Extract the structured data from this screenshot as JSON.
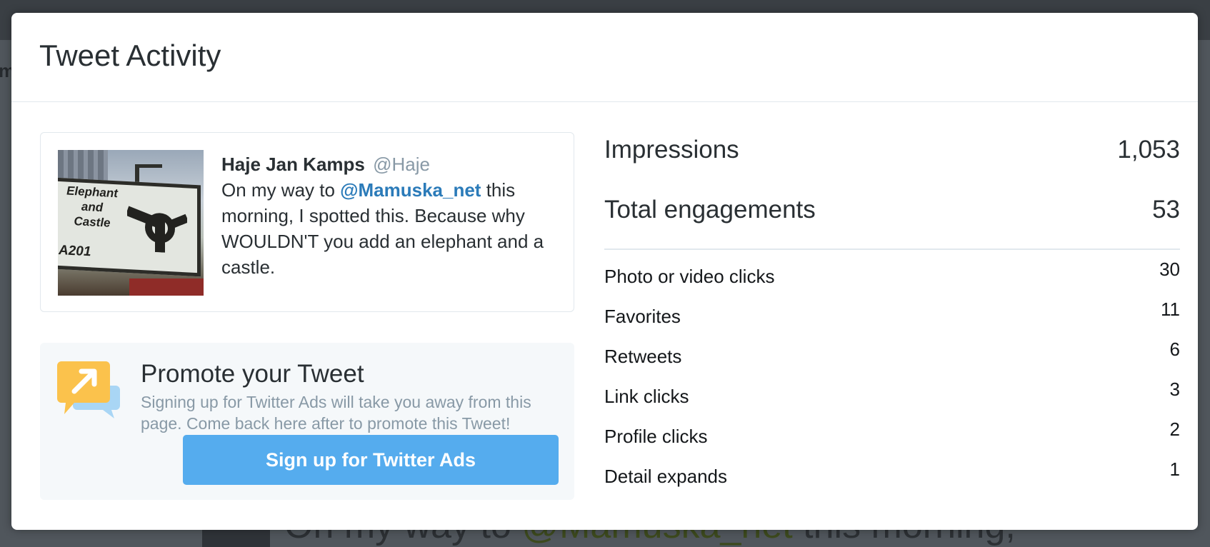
{
  "modal": {
    "title": "Tweet Activity"
  },
  "tweet": {
    "author_name": "Haje Jan Kamps",
    "author_handle": "@Haje",
    "text_before": "On my way to ",
    "mention": "@Mamuska_net",
    "text_after": " this morning, I spotted this. Because why WOULDN'T you add an elephant and a castle.",
    "photo": {
      "sign_lines": [
        "Elephant",
        "and",
        "Castle"
      ],
      "sign_road": "A201"
    }
  },
  "promote": {
    "title": "Promote your Tweet",
    "description": "Signing up for Twitter Ads will take you away from this page. Come back here after to promote this Tweet!",
    "button_label": "Sign up for Twitter Ads",
    "icon": "promote-tweet-icon"
  },
  "stats": {
    "impressions": {
      "label": "Impressions",
      "value": "1,053"
    },
    "total_engagements": {
      "label": "Total engagements",
      "value": "53"
    },
    "breakdown": [
      {
        "label": "Photo or video clicks",
        "value": "30"
      },
      {
        "label": "Favorites",
        "value": "11"
      },
      {
        "label": "Retweets",
        "value": "6"
      },
      {
        "label": "Link clicks",
        "value": "3"
      },
      {
        "label": "Profile clicks",
        "value": "2"
      },
      {
        "label": "Detail expands",
        "value": "1"
      }
    ]
  },
  "background": {
    "tweet_text_start": "On my way to ",
    "tweet_mention": "@Mamuska_net",
    "tweet_text_end": " this morning,"
  },
  "colors": {
    "accent": "#55acee",
    "mention": "#2b7bb9",
    "muted": "#8899a6",
    "text": "#292f33"
  }
}
